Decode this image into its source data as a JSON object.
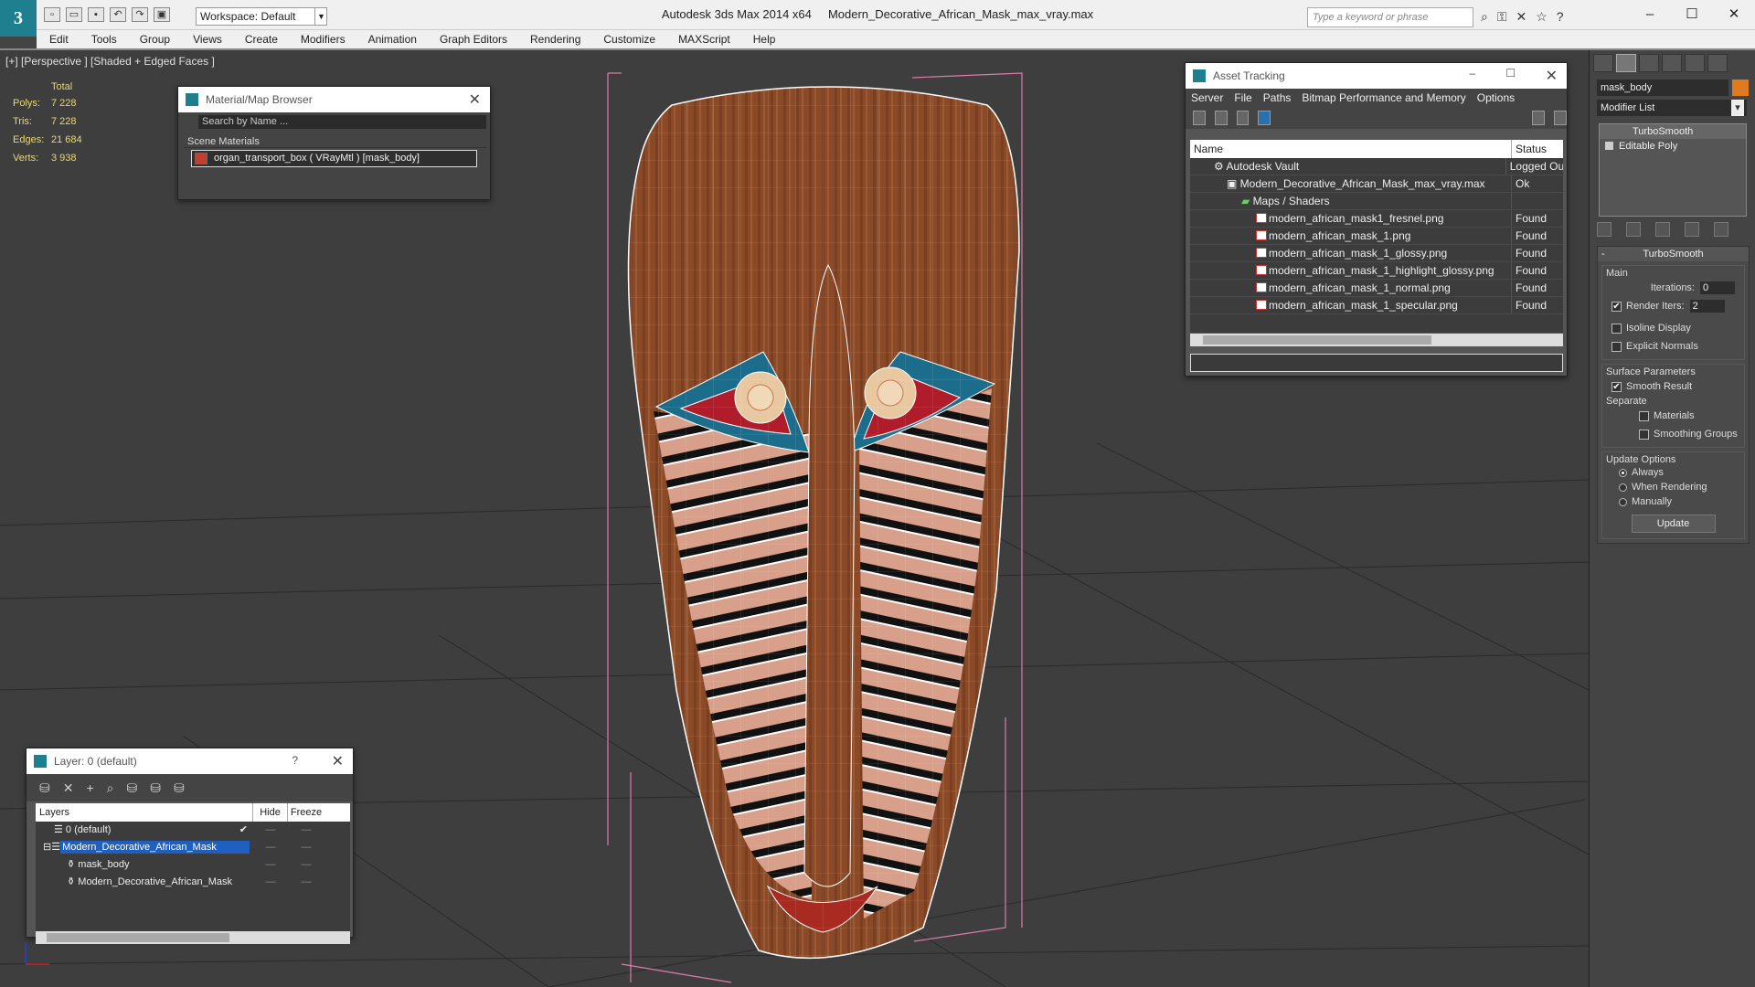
{
  "app": {
    "title_app": "Autodesk 3ds Max  2014 x64",
    "title_file": "Modern_Decorative_African_Mask_max_vray.max",
    "workspace": "Workspace: Default",
    "search_placeholder": "Type a keyword or phrase"
  },
  "menu": [
    "Edit",
    "Tools",
    "Group",
    "Views",
    "Create",
    "Modifiers",
    "Animation",
    "Graph Editors",
    "Rendering",
    "Customize",
    "MAXScript",
    "Help"
  ],
  "viewport": {
    "label": "[+] [Perspective ] [Shaded + Edged Faces ]",
    "stats": {
      "header": "Total",
      "rows": [
        {
          "k": "Polys:",
          "v": "7 228"
        },
        {
          "k": "Tris:",
          "v": "7 228"
        },
        {
          "k": "Edges:",
          "v": "21 684"
        },
        {
          "k": "Verts:",
          "v": "3 938"
        }
      ]
    }
  },
  "material_browser": {
    "title": "Material/Map Browser",
    "search_placeholder": "Search by Name ...",
    "section": "Scene Materials",
    "item": "organ_transport_box ( VRayMtl ) [mask_body]"
  },
  "asset_tracking": {
    "title": "Asset Tracking",
    "menu": [
      "Server",
      "File",
      "Paths",
      "Bitmap Performance and Memory",
      "Options"
    ],
    "columns": [
      "Name",
      "Status"
    ],
    "rows": [
      {
        "name": "Autodesk Vault",
        "status": "Logged Ou"
      },
      {
        "name": "Modern_Decorative_African_Mask_max_vray.max",
        "status": "Ok"
      },
      {
        "name": "Maps / Shaders",
        "status": ""
      },
      {
        "name": "modern_african_mask1_fresnel.png",
        "status": "Found"
      },
      {
        "name": "modern_african_mask_1.png",
        "status": "Found"
      },
      {
        "name": "modern_african_mask_1_glossy.png",
        "status": "Found"
      },
      {
        "name": "modern_african_mask_1_highlight_glossy.png",
        "status": "Found"
      },
      {
        "name": "modern_african_mask_1_normal.png",
        "status": "Found"
      },
      {
        "name": "modern_african_mask_1_specular.png",
        "status": "Found"
      }
    ]
  },
  "layer_manager": {
    "title": "Layer: 0 (default)",
    "help": "?",
    "columns": [
      "Layers",
      "Hide",
      "Freeze"
    ],
    "rows": [
      {
        "name": "0 (default)"
      },
      {
        "name": "Modern_Decorative_African_Mask"
      },
      {
        "name": "mask_body"
      },
      {
        "name": "Modern_Decorative_African_Mask"
      }
    ]
  },
  "command_panel": {
    "object_name": "mask_body",
    "object_color": "#e07a20",
    "modifier_list": "Modifier List",
    "stack": [
      "TurboSmooth",
      "Editable Poly"
    ],
    "rollout_title": "TurboSmooth",
    "main_label": "Main",
    "iterations_label": "Iterations:",
    "iterations_value": "0",
    "render_iters_label": "Render Iters:",
    "render_iters_value": "2",
    "isoline": "Isoline Display",
    "explicit_normals": "Explicit Normals",
    "surface_params": "Surface Parameters",
    "smooth_result": "Smooth Result",
    "separate": "Separate",
    "materials": "Materials",
    "smoothing_groups": "Smoothing Groups",
    "update_options": "Update Options",
    "always": "Always",
    "when_rendering": "When Rendering",
    "manually": "Manually",
    "update_button": "Update"
  }
}
